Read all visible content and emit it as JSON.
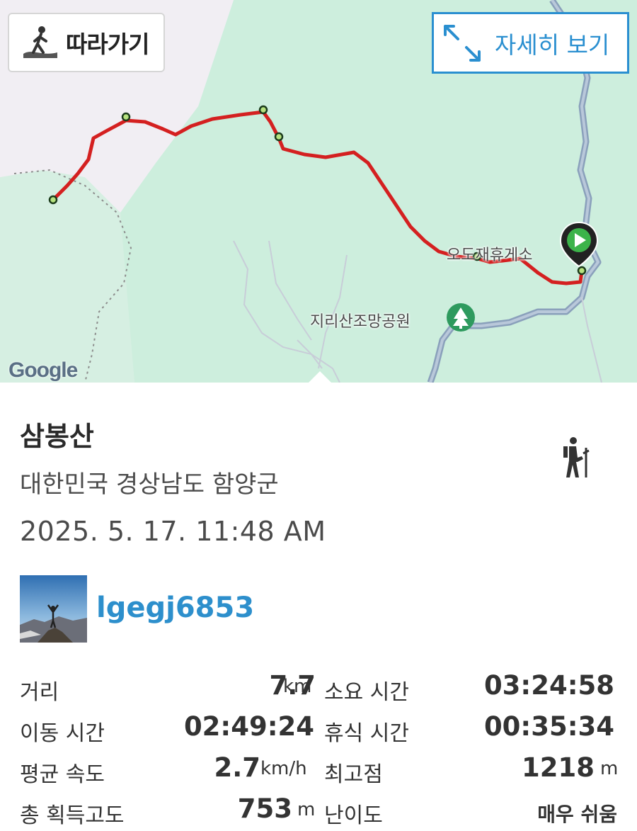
{
  "map": {
    "follow_label": "따라가기",
    "detail_label": "자세히 보기",
    "poi_rest_area": "오도재휴게소",
    "poi_park": "지리산조망공원",
    "attribution": "Google"
  },
  "trail": {
    "title": "삼봉산",
    "region": "대한민국 경상남도 함양군",
    "datetime": "2025. 5. 17. 11:48 AM",
    "username": "lgegj6853"
  },
  "stats": {
    "distance_label": "거리",
    "distance_value": "7.7",
    "distance_unit": "km",
    "total_time_label": "소요 시간",
    "total_time_value": "03:24:58",
    "moving_time_label": "이동 시간",
    "moving_time_value": "02:49:24",
    "rest_time_label": "휴식 시간",
    "rest_time_value": "00:35:34",
    "avg_speed_label": "평균 속도",
    "avg_speed_value": "2.7",
    "avg_speed_unit": "km/h",
    "max_elev_label": "최고점",
    "max_elev_value": "1218",
    "max_elev_unit": "m",
    "elev_gain_label": "총 획득고도",
    "elev_gain_value": "753",
    "elev_gain_unit": "m",
    "difficulty_label": "난이도",
    "difficulty_value": "매우 쉬움"
  },
  "colors": {
    "accent": "#2a8fd0",
    "route": "#d42020",
    "park": "#cdeedd",
    "river": "#8aa0bb"
  },
  "icons": [
    "hiker-follow-icon",
    "expand-icon",
    "start-pin-icon",
    "park-tree-icon",
    "hiking-icon"
  ]
}
